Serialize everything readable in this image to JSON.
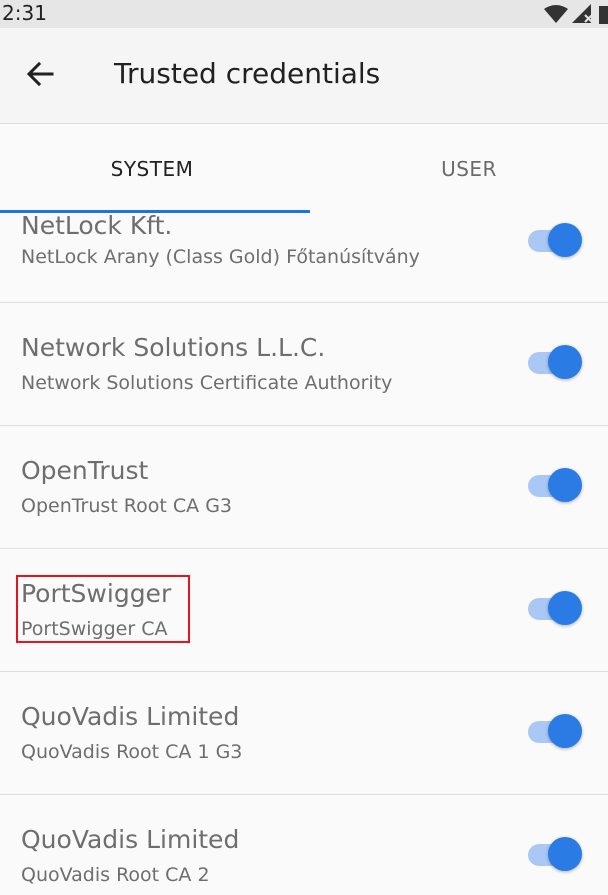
{
  "status_bar": {
    "time": "2:31",
    "icons": [
      "wifi-icon",
      "signal-icon",
      "battery-icon"
    ]
  },
  "app_bar": {
    "back_icon": "back-arrow-icon",
    "title": "Trusted credentials"
  },
  "tabs": [
    {
      "label": "SYSTEM",
      "selected": true
    },
    {
      "label": "USER",
      "selected": false
    }
  ],
  "certificates": [
    {
      "org": "NetLock Kft.",
      "name": "NetLock Arany (Class Gold) Főtanúsítvány",
      "enabled": true
    },
    {
      "org": "Network Solutions L.L.C.",
      "name": "Network Solutions Certificate Authority",
      "enabled": true
    },
    {
      "org": "OpenTrust",
      "name": "OpenTrust Root CA G3",
      "enabled": true
    },
    {
      "org": "PortSwigger",
      "name": "PortSwigger CA",
      "enabled": true,
      "highlighted": true
    },
    {
      "org": "QuoVadis Limited",
      "name": "QuoVadis Root CA 1 G3",
      "enabled": true
    },
    {
      "org": "QuoVadis Limited",
      "name": "QuoVadis Root CA 2",
      "enabled": true
    }
  ],
  "colors": {
    "accent": "#1a73e8",
    "toggle_thumb": "#2a7be4",
    "toggle_track": "#aac8f5",
    "highlight": "#e8141d"
  }
}
